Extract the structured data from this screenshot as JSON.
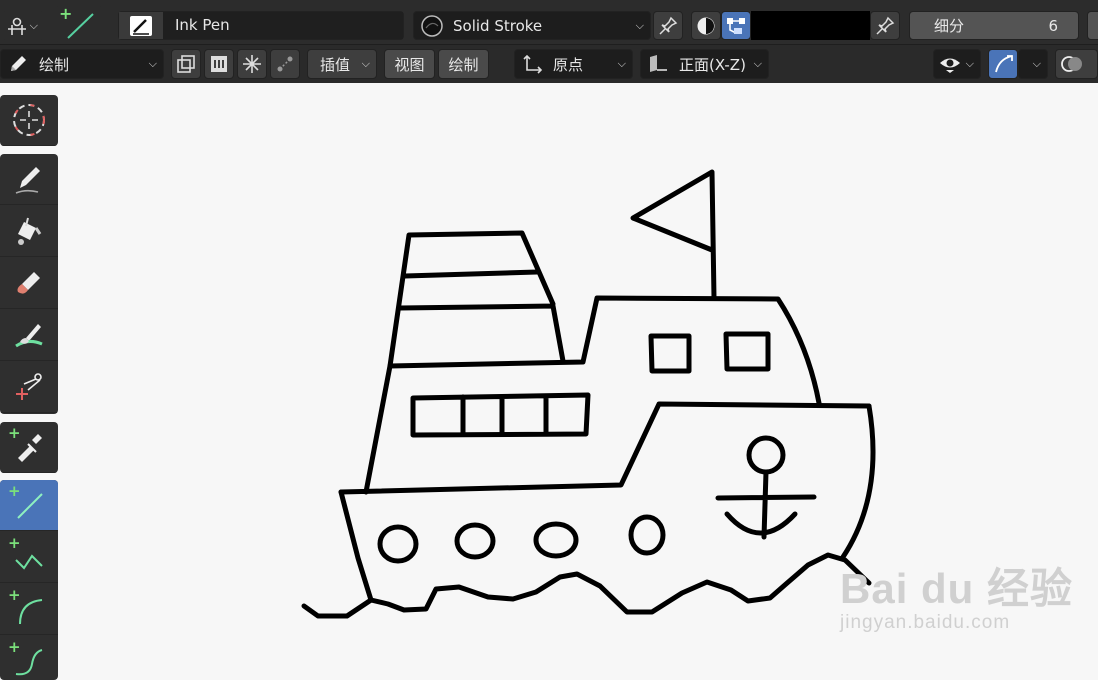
{
  "topbar": {
    "brush_name": "Ink Pen",
    "stroke_material": "Solid Stroke",
    "subdivision_label": "细分",
    "subdivision_value": "6",
    "color_swatch": "#000000",
    "icons": [
      "snap-transform-icon",
      "line-tool-icon",
      "brush-preview-icon",
      "material-sphere-icon",
      "pin-icon",
      "color-mode-icon",
      "vertex-color-icon"
    ]
  },
  "toolbar2": {
    "mode_label": "绘制",
    "interpolate_label": "插值",
    "view_menu": "视图",
    "draw_menu": "绘制",
    "origin_label": "原点",
    "orientation_label": "正面(X-Z)"
  },
  "tools": {
    "items": [
      "cursor",
      "draw",
      "fill",
      "erase",
      "tint",
      "cutter",
      "eyedropper",
      "line",
      "polyline",
      "arc",
      "curve"
    ],
    "active": "line"
  },
  "colors": {
    "accent": "#4a74b8",
    "plus": "#7be07b",
    "header_bg": "#2c2c2c",
    "canvas_bg": "#f7f7f7"
  },
  "watermark": {
    "logo": "Bai du 经验",
    "url": "jingyan.baidu.com"
  }
}
